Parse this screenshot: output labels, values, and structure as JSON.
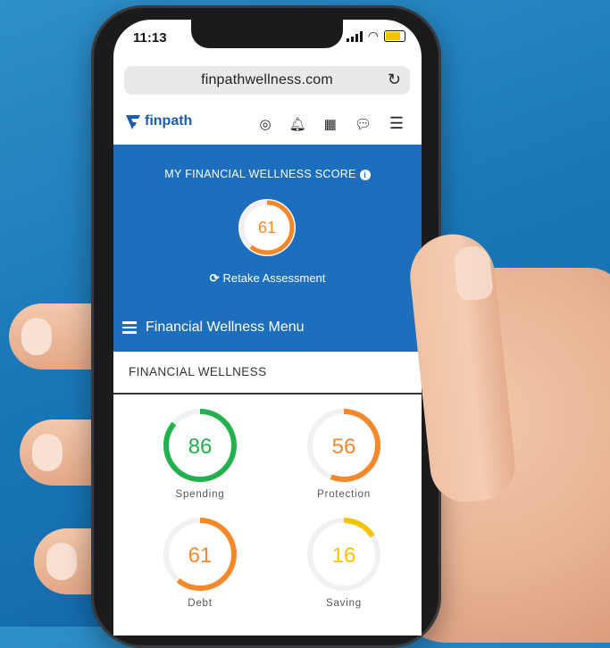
{
  "status": {
    "time": "11:13"
  },
  "browser": {
    "url": "finpathwellness.com"
  },
  "nav": {
    "logo_text": "finpath"
  },
  "hero": {
    "title": "MY FINANCIAL WELLNESS SCORE",
    "score": 61,
    "retake_label": "Retake Assessment",
    "menu_label": "Financial Wellness Menu"
  },
  "section": {
    "title": "FINANCIAL WELLNESS"
  },
  "gauges": [
    {
      "label": "Spending",
      "value": 86,
      "color": "#22b14c"
    },
    {
      "label": "Protection",
      "value": 56,
      "color": "#f5892a"
    },
    {
      "label": "Debt",
      "value": 61,
      "color": "#f5892a"
    },
    {
      "label": "Saving",
      "value": 16,
      "color": "#f5c400"
    }
  ],
  "colors": {
    "primary": "#1d6fbd",
    "score_orange": "#f5892a"
  },
  "icons": [
    "support-icon",
    "bell-icon",
    "calendar-icon",
    "chat-icon",
    "menu-icon",
    "info-icon",
    "refresh-icon"
  ]
}
